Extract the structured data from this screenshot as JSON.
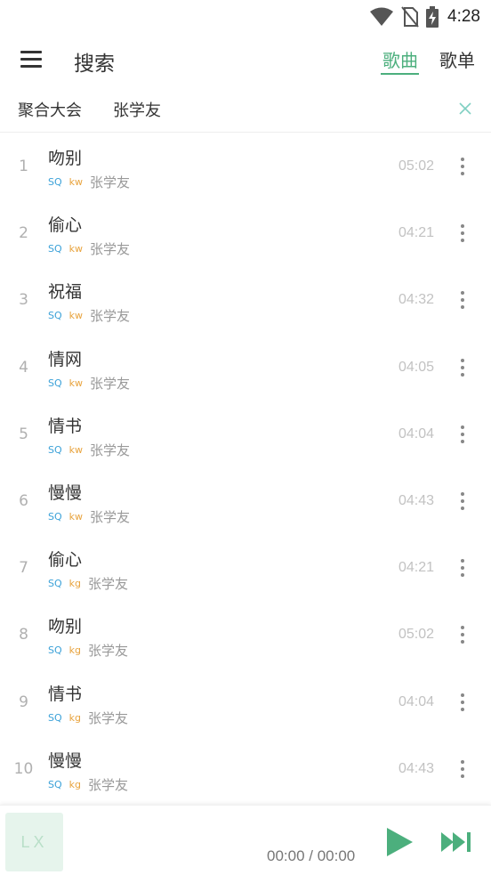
{
  "status_bar": {
    "time": "4:28",
    "icons": [
      "wifi-icon",
      "no-sim-icon",
      "battery-charging-icon"
    ]
  },
  "app_bar": {
    "title": "搜索",
    "tabs": [
      {
        "label": "歌曲",
        "active": true
      },
      {
        "label": "歌单",
        "active": false
      }
    ]
  },
  "search": {
    "source": "聚合大会",
    "query": "张学友"
  },
  "songs": [
    {
      "index": "1",
      "title": "吻别",
      "quality": "SQ",
      "source": "kw",
      "artist": "张学友",
      "duration": "05:02"
    },
    {
      "index": "2",
      "title": "偷心",
      "quality": "SQ",
      "source": "kw",
      "artist": "张学友",
      "duration": "04:21"
    },
    {
      "index": "3",
      "title": "祝福",
      "quality": "SQ",
      "source": "kw",
      "artist": "张学友",
      "duration": "04:32"
    },
    {
      "index": "4",
      "title": "情网",
      "quality": "SQ",
      "source": "kw",
      "artist": "张学友",
      "duration": "04:05"
    },
    {
      "index": "5",
      "title": "情书",
      "quality": "SQ",
      "source": "kw",
      "artist": "张学友",
      "duration": "04:04"
    },
    {
      "index": "6",
      "title": "慢慢",
      "quality": "SQ",
      "source": "kw",
      "artist": "张学友",
      "duration": "04:43"
    },
    {
      "index": "7",
      "title": "偷心",
      "quality": "SQ",
      "source": "kg",
      "artist": "张学友",
      "duration": "04:21"
    },
    {
      "index": "8",
      "title": "吻别",
      "quality": "SQ",
      "source": "kg",
      "artist": "张学友",
      "duration": "05:02"
    },
    {
      "index": "9",
      "title": "情书",
      "quality": "SQ",
      "source": "kg",
      "artist": "张学友",
      "duration": "04:04"
    },
    {
      "index": "10",
      "title": "慢慢",
      "quality": "SQ",
      "source": "kg",
      "artist": "张学友",
      "duration": "04:43"
    }
  ],
  "player": {
    "cover_text": "LX",
    "time": "00:00 / 00:00"
  },
  "colors": {
    "accent": "#4caf7d",
    "sq_tag": "#3ba1d8",
    "source_tag": "#e8a33d",
    "cover_bg": "#e6f4ec"
  }
}
